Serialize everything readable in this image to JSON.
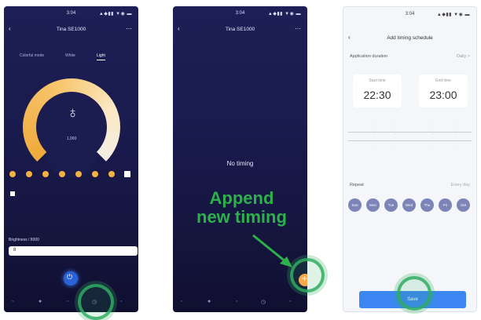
{
  "screen1": {
    "status_time": "3:04",
    "status_icons": "▲◆▮▮ ▼◉ ▬",
    "title": "Tina SE1000",
    "tabs": [
      "Colorful mode",
      "White",
      "Light"
    ],
    "dial_value": "1,000",
    "brightness_label": "Brightness / 8000",
    "brightness_value": "8"
  },
  "screen2": {
    "status_time": "3:04",
    "status_icons": "▲◆▮▮ ▼◉ ▬",
    "title": "Tina SE1000",
    "empty_text": "No timing",
    "annotation": "Append\nnew timing"
  },
  "screen3": {
    "status_time": "3:04",
    "status_icons": "▲◆▮▮ ▼◉ ▬",
    "title": "Add timing schedule",
    "application_label": "Application duration",
    "application_value": "Daily >",
    "start_label": "Start time",
    "start_time": "22:30",
    "end_label": "End time",
    "end_time": "23:00",
    "repeat_label": "Repeat",
    "repeat_value": "Every day",
    "days": [
      "Sun",
      "Mon",
      "Tue",
      "Wed",
      "Thu",
      "Fri",
      "Sat"
    ],
    "save_label": "Save"
  },
  "colors": {
    "accent_orange": "#f6a94c",
    "highlight_green": "#2db14b",
    "primary_blue": "#3b86f0"
  }
}
